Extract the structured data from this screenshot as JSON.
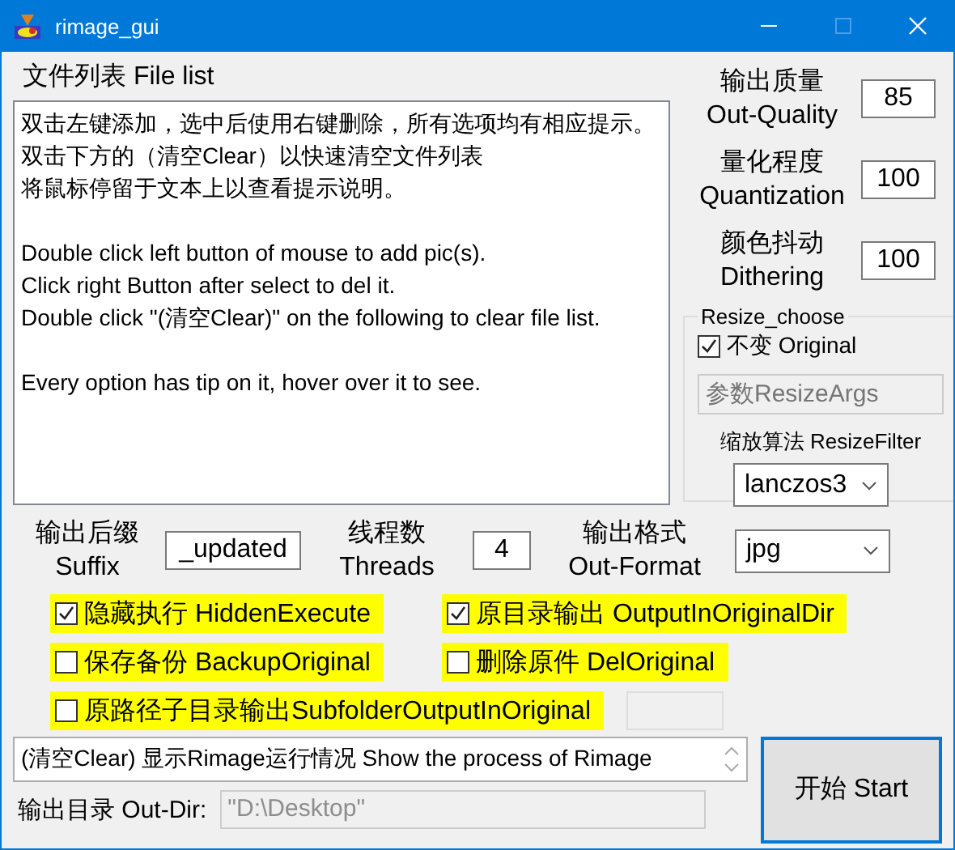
{
  "window": {
    "title": "rimage_gui"
  },
  "file_list": {
    "label": "文件列表 File list",
    "paragraphs": [
      [
        "双击左键添加，选中后使用右键删除，所有选项均有相应提示。",
        "双击下方的（清空Clear）以快速清空文件列表",
        "将鼠标停留于文本上以查看提示说明。"
      ],
      [
        "Double click left button of mouse to add pic(s).",
        "Click right Button after select to del it.",
        "Double click \"(清空Clear)\" on the following to clear file list."
      ],
      [
        "Every option has tip on it, hover over it to see."
      ]
    ]
  },
  "settings": [
    {
      "label": [
        "输出质量",
        "Out-Quality"
      ],
      "value": "85"
    },
    {
      "label": [
        "量化程度",
        "Quantization"
      ],
      "value": "100"
    },
    {
      "label": [
        "颜色抖动",
        "Dithering"
      ],
      "value": "100"
    }
  ],
  "resize": {
    "title": "Resize_choose",
    "original": {
      "label": "不变 Original",
      "checked": true
    },
    "args": {
      "placeholder": "参数ResizeArgs",
      "disabled": true
    },
    "filter_label": "缩放算法 ResizeFilter",
    "filter": {
      "value": "lanczos3"
    }
  },
  "suffix": {
    "label": [
      "输出后缀",
      "Suffix"
    ],
    "value": "_updated"
  },
  "threads": {
    "label": [
      "线程数",
      "Threads"
    ],
    "value": "4"
  },
  "format": {
    "label": [
      "输出格式",
      "Out-Format"
    ],
    "value": "jpg"
  },
  "options": [
    {
      "label": "隐藏执行 HiddenExecute",
      "checked": true
    },
    {
      "label": "原目录输出 OutputInOriginalDir",
      "checked": true
    },
    {
      "label": "保存备份 BackupOriginal",
      "checked": false
    },
    {
      "label": "删除原件 DelOriginal",
      "checked": false
    },
    {
      "label": "原路径子目录输出SubfolderOutputInOriginal",
      "checked": false
    }
  ],
  "subfolder_field": {
    "disabled": true
  },
  "status": {
    "text": "(清空Clear) 显示Rimage运行情况 Show the process of Rimage"
  },
  "start_button": {
    "label": "开始 Start"
  },
  "out_dir": {
    "label": "输出目录 Out-Dir:",
    "value": "\"D:\\Desktop\"",
    "disabled": true
  }
}
